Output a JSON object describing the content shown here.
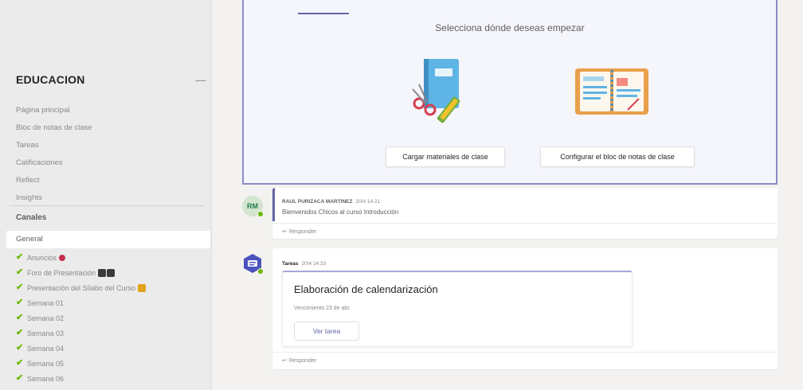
{
  "sidebar": {
    "team_name": "EDUCACION",
    "more_icon": "ellipsis-icon",
    "nav_items": [
      "Página principal",
      "Bloc de notas de clase",
      "Tareas",
      "Calificaciones",
      "Reflect",
      "Insights"
    ],
    "channels_title": "Canales",
    "general_label": "General",
    "channels": [
      {
        "label": "Anuncios",
        "emoji": "megaphone"
      },
      {
        "label": "Foro de Presentación",
        "emoji": "people"
      },
      {
        "label": "Presentación del Sílabo del Curso",
        "emoji": "clipboard"
      },
      {
        "label": "Semana 01"
      },
      {
        "label": "Semana 02"
      },
      {
        "label": "Semana 03"
      },
      {
        "label": "Semana 04"
      },
      {
        "label": "Semana 05"
      },
      {
        "label": "Semana 06"
      }
    ]
  },
  "welcome": {
    "title": "Selecciona dónde deseas empezar",
    "upload_button": "Cargar materiales de clase",
    "notebook_button": "Configurar el bloc de notas de clase"
  },
  "post1": {
    "avatar_initials": "RM",
    "author": "RAUL PURIZACA MARTINEZ",
    "time": "20/4 14:21",
    "text": "Bienvenidos Chicos al curso Introducción",
    "reply": "Responder"
  },
  "post2": {
    "author": "Tareas",
    "time": "20/4 14:33",
    "assignment_title": "Elaboración de calendarización",
    "due": "Vencimiento 23 de abr.",
    "view_button": "Ver tarea",
    "reply": "Responder"
  },
  "colors": {
    "accent": "#6264a7",
    "check": "#6bb700",
    "sidebar_bg": "#ebebeb",
    "main_bg": "#f3f2f1"
  }
}
